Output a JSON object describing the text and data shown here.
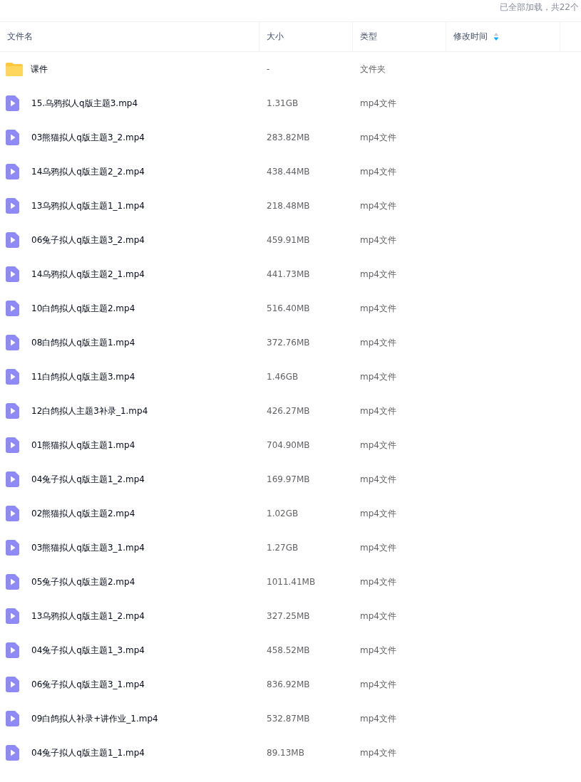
{
  "status_text": "已全部加载，共22个",
  "columns": [
    {
      "label": "文件名",
      "sorted": false
    },
    {
      "label": "大小",
      "sorted": false
    },
    {
      "label": "类型",
      "sorted": false
    },
    {
      "label": "修改时间",
      "sorted": true
    }
  ],
  "rows": [
    {
      "kind": "folder",
      "name": "课件",
      "size": "-",
      "type": "文件夹"
    },
    {
      "kind": "video",
      "name": "15.乌鸦拟人q版主题3.mp4",
      "size": "1.31GB",
      "type": "mp4文件"
    },
    {
      "kind": "video",
      "name": "03熊猫拟人q版主题3_2.mp4",
      "size": "283.82MB",
      "type": "mp4文件"
    },
    {
      "kind": "video",
      "name": "14乌鸦拟人q版主题2_2.mp4",
      "size": "438.44MB",
      "type": "mp4文件"
    },
    {
      "kind": "video",
      "name": "13乌鸦拟人q版主题1_1.mp4",
      "size": "218.48MB",
      "type": "mp4文件"
    },
    {
      "kind": "video",
      "name": "06兔子拟人q版主题3_2.mp4",
      "size": "459.91MB",
      "type": "mp4文件"
    },
    {
      "kind": "video",
      "name": "14乌鸦拟人q版主题2_1.mp4",
      "size": "441.73MB",
      "type": "mp4文件"
    },
    {
      "kind": "video",
      "name": "10白鸽拟人q版主题2.mp4",
      "size": "516.40MB",
      "type": "mp4文件"
    },
    {
      "kind": "video",
      "name": "08白鸽拟人q版主题1.mp4",
      "size": "372.76MB",
      "type": "mp4文件"
    },
    {
      "kind": "video",
      "name": "11白鸽拟人q版主题3.mp4",
      "size": "1.46GB",
      "type": "mp4文件"
    },
    {
      "kind": "video",
      "name": "12白鸽拟人主题3补录_1.mp4",
      "size": "426.27MB",
      "type": "mp4文件"
    },
    {
      "kind": "video",
      "name": "01熊猫拟人q版主题1.mp4",
      "size": "704.90MB",
      "type": "mp4文件"
    },
    {
      "kind": "video",
      "name": "04兔子拟人q版主题1_2.mp4",
      "size": "169.97MB",
      "type": "mp4文件"
    },
    {
      "kind": "video",
      "name": "02熊猫拟人q版主题2.mp4",
      "size": "1.02GB",
      "type": "mp4文件"
    },
    {
      "kind": "video",
      "name": "03熊猫拟人q版主题3_1.mp4",
      "size": "1.27GB",
      "type": "mp4文件"
    },
    {
      "kind": "video",
      "name": "05兔子拟人q版主题2.mp4",
      "size": "1011.41MB",
      "type": "mp4文件"
    },
    {
      "kind": "video",
      "name": "13乌鸦拟人q版主题1_2.mp4",
      "size": "327.25MB",
      "type": "mp4文件"
    },
    {
      "kind": "video",
      "name": "04兔子拟人q版主题1_3.mp4",
      "size": "458.52MB",
      "type": "mp4文件"
    },
    {
      "kind": "video",
      "name": "06兔子拟人q版主题3_1.mp4",
      "size": "836.92MB",
      "type": "mp4文件"
    },
    {
      "kind": "video",
      "name": "09白鸽拟人补录+讲作业_1.mp4",
      "size": "532.87MB",
      "type": "mp4文件"
    },
    {
      "kind": "video",
      "name": "04兔子拟人q版主题1_1.mp4",
      "size": "89.13MB",
      "type": "mp4文件"
    }
  ]
}
